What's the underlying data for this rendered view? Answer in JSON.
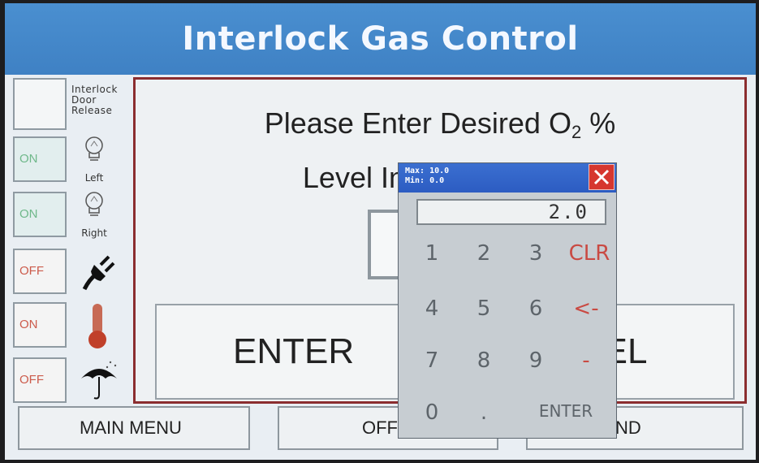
{
  "header": {
    "title": "Interlock Gas Control"
  },
  "sidebar": {
    "door_release": {
      "label_lines": [
        "Interlock",
        "Door",
        "Release"
      ]
    },
    "rows": [
      {
        "state": "ON",
        "icon": "light-bulb-icon",
        "caption": "Left"
      },
      {
        "state": "ON",
        "icon": "light-bulb-icon",
        "caption": "Right"
      },
      {
        "state": "OFF",
        "icon": "power-plug-icon",
        "caption": ""
      },
      {
        "state": "ON",
        "icon": "thermometer-icon",
        "caption": ""
      },
      {
        "state": "OFF",
        "icon": "umbrella-rain-icon",
        "caption": ""
      }
    ]
  },
  "dialog": {
    "prompt_line1_pre": "Please Enter Desired O",
    "prompt_line1_sub": "2",
    "prompt_line1_post": " %",
    "prompt_line2": "Level Inside Interlock",
    "enter_label": "ENTER",
    "cancel_label": "CANCEL"
  },
  "footer": {
    "main_menu_label": "MAIN MENU",
    "off_label": "OFF",
    "trend_label": "TREND"
  },
  "keypad": {
    "max_label": "Max: 10.0",
    "min_label": "Min: 0.0",
    "display_value": "2.0",
    "keys": [
      [
        "1",
        "2",
        "3",
        "CLR"
      ],
      [
        "4",
        "5",
        "6",
        "<-"
      ],
      [
        "7",
        "8",
        "9",
        "-"
      ],
      [
        "0",
        ".",
        "ENTER"
      ]
    ]
  },
  "colors": {
    "header_blue": "#4a8fd0",
    "dialog_border": "#8b2d2f",
    "on_green": "#6fb88a",
    "off_red": "#cc5b4b",
    "keypad_header": "#3b6fd0",
    "close_red": "#d6372f"
  }
}
